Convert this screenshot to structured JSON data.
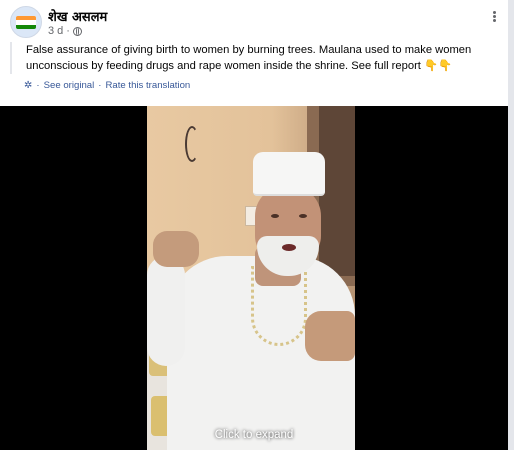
{
  "post": {
    "author": "शेख असलम",
    "time": "3 d",
    "separator": "·",
    "text": "False assurance of giving birth to women by burning trees. Maulana used to make women unconscious by feeding drugs and rape women inside the shrine. See full report 👇👇",
    "see_original": "See original",
    "dot": "·",
    "rate_translation": "Rate this translation"
  },
  "video": {
    "expand_label": "Click to expand"
  },
  "icons": {
    "avatar_flag": "india-flag-icon",
    "privacy": "globe-icon",
    "more": "more-options-icon",
    "translate": "gear-icon"
  },
  "colors": {
    "link": "#385898",
    "meta": "#65676b",
    "text": "#050505",
    "flag_saffron": "#ff9933",
    "flag_white": "#ffffff",
    "flag_green": "#138808"
  }
}
